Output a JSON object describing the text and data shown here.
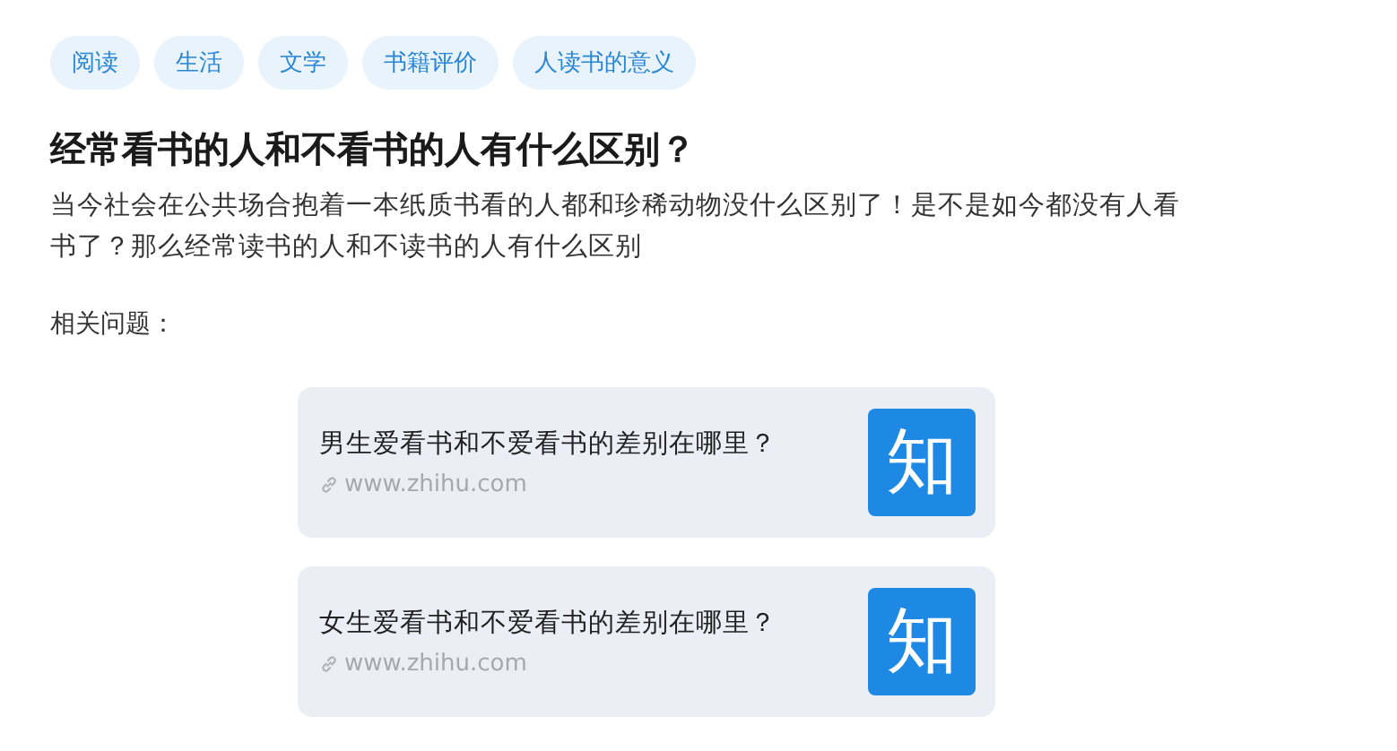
{
  "tags": [
    "阅读",
    "生活",
    "文学",
    "书籍评价",
    "人读书的意义"
  ],
  "title": "经常看书的人和不看书的人有什么区别？",
  "description": "当今社会在公共场合抱着一本纸质书看的人都和珍稀动物没什么区别了！是不是如今都没有人看书了？那么经常读书的人和不读书的人有什么区别",
  "related_label": "相关问题：",
  "related": [
    {
      "title": "男生爱看书和不爱看书的差别在哪里？",
      "source": "www.zhihu.com",
      "logo": "知"
    },
    {
      "title": "女生爱看书和不爱看书的差别在哪里？",
      "source": "www.zhihu.com",
      "logo": "知"
    }
  ]
}
